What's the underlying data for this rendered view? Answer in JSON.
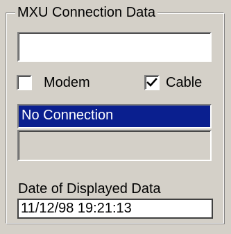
{
  "group": {
    "title": "MXU Connection Data"
  },
  "connection_field": {
    "value": ""
  },
  "checkboxes": {
    "modem": {
      "label": "Modem",
      "checked": false
    },
    "cable": {
      "label": "Cable",
      "checked": true
    }
  },
  "status": {
    "text": "No Connection"
  },
  "details_field": {
    "value": ""
  },
  "date": {
    "label": "Date of Displayed Data",
    "value": "11/12/98 19:21:13"
  },
  "colors": {
    "background": "#d4d0c8",
    "status_background": "#0a1f8f",
    "status_text": "#ffffff"
  }
}
